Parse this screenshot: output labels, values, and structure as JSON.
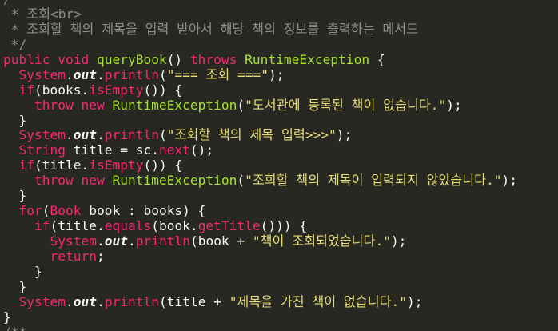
{
  "editor": {
    "lines": [
      [
        {
          "c": "comment",
          "t": "/"
        }
      ],
      [
        {
          "c": "comment",
          "t": " * 조회"
        },
        {
          "c": "tag",
          "t": "<br>"
        }
      ],
      [
        {
          "c": "comment",
          "t": " * 조회할 책의 제목을 입력 받아서 해당 책의 정보를 출력하는 메서드"
        }
      ],
      [
        {
          "c": "comment",
          "t": " */"
        }
      ],
      [
        {
          "c": "kw",
          "t": "public "
        },
        {
          "c": "kw",
          "t": "void "
        },
        {
          "c": "fn",
          "t": "queryBook"
        },
        {
          "c": "plain",
          "t": "() "
        },
        {
          "c": "kw",
          "t": "throws "
        },
        {
          "c": "cls",
          "t": "RuntimeException"
        },
        {
          "c": "plain",
          "t": " {"
        }
      ],
      [
        {
          "c": "plain",
          "t": "  "
        },
        {
          "c": "kw",
          "t": "System"
        },
        {
          "c": "plain",
          "t": "."
        },
        {
          "c": "field",
          "t": "out"
        },
        {
          "c": "plain",
          "t": "."
        },
        {
          "c": "kw",
          "t": "println"
        },
        {
          "c": "plain",
          "t": "("
        },
        {
          "c": "str",
          "t": "\"=== 조회 ===\""
        },
        {
          "c": "plain",
          "t": ");"
        }
      ],
      [
        {
          "c": "plain",
          "t": "  "
        },
        {
          "c": "kw",
          "t": "if"
        },
        {
          "c": "plain",
          "t": "(books."
        },
        {
          "c": "kw",
          "t": "isEmpty"
        },
        {
          "c": "plain",
          "t": "()) {"
        }
      ],
      [
        {
          "c": "plain",
          "t": "    "
        },
        {
          "c": "kw",
          "t": "throw new "
        },
        {
          "c": "cls",
          "t": "RuntimeException"
        },
        {
          "c": "plain",
          "t": "("
        },
        {
          "c": "str",
          "t": "\"도서관에 등록된 책이 없습니다.\""
        },
        {
          "c": "plain",
          "t": ");"
        }
      ],
      [
        {
          "c": "plain",
          "t": "  }"
        }
      ],
      [
        {
          "c": "plain",
          "t": "  "
        },
        {
          "c": "kw",
          "t": "System"
        },
        {
          "c": "plain",
          "t": "."
        },
        {
          "c": "field",
          "t": "out"
        },
        {
          "c": "plain",
          "t": "."
        },
        {
          "c": "kw",
          "t": "println"
        },
        {
          "c": "plain",
          "t": "("
        },
        {
          "c": "str",
          "t": "\"조회할 책의 제목 입력>>>\""
        },
        {
          "c": "plain",
          "t": ");"
        }
      ],
      [
        {
          "c": "plain",
          "t": "  "
        },
        {
          "c": "kw",
          "t": "String "
        },
        {
          "c": "plain",
          "t": "title = sc."
        },
        {
          "c": "kw",
          "t": "next"
        },
        {
          "c": "plain",
          "t": "();"
        }
      ],
      [
        {
          "c": "plain",
          "t": "  "
        },
        {
          "c": "kw",
          "t": "if"
        },
        {
          "c": "plain",
          "t": "(title."
        },
        {
          "c": "kw",
          "t": "isEmpty"
        },
        {
          "c": "plain",
          "t": "()) {"
        }
      ],
      [
        {
          "c": "plain",
          "t": "    "
        },
        {
          "c": "kw",
          "t": "throw new "
        },
        {
          "c": "cls",
          "t": "RuntimeException"
        },
        {
          "c": "plain",
          "t": "("
        },
        {
          "c": "str",
          "t": "\"조회할 책의 제목이 입력되지 않았습니다.\""
        },
        {
          "c": "plain",
          "t": ");"
        }
      ],
      [
        {
          "c": "plain",
          "t": "  }"
        }
      ],
      [
        {
          "c": "plain",
          "t": "  "
        },
        {
          "c": "kw",
          "t": "for"
        },
        {
          "c": "plain",
          "t": "("
        },
        {
          "c": "kw",
          "t": "Book "
        },
        {
          "c": "plain",
          "t": "book : books) {"
        }
      ],
      [
        {
          "c": "plain",
          "t": "    "
        },
        {
          "c": "kw",
          "t": "if"
        },
        {
          "c": "plain",
          "t": "(title."
        },
        {
          "c": "kw",
          "t": "equals"
        },
        {
          "c": "plain",
          "t": "(book."
        },
        {
          "c": "kw",
          "t": "getTitle"
        },
        {
          "c": "plain",
          "t": "())) {"
        }
      ],
      [
        {
          "c": "plain",
          "t": "      "
        },
        {
          "c": "kw",
          "t": "System"
        },
        {
          "c": "plain",
          "t": "."
        },
        {
          "c": "field",
          "t": "out"
        },
        {
          "c": "plain",
          "t": "."
        },
        {
          "c": "kw",
          "t": "println"
        },
        {
          "c": "plain",
          "t": "(book + "
        },
        {
          "c": "str",
          "t": "\"책이 조회되었습니다.\""
        },
        {
          "c": "plain",
          "t": ");"
        }
      ],
      [
        {
          "c": "plain",
          "t": "      "
        },
        {
          "c": "kw",
          "t": "return"
        },
        {
          "c": "plain",
          "t": ";"
        }
      ],
      [
        {
          "c": "plain",
          "t": "    }"
        }
      ],
      [
        {
          "c": "plain",
          "t": "  }"
        }
      ],
      [
        {
          "c": "plain",
          "t": "  "
        },
        {
          "c": "kw",
          "t": "System"
        },
        {
          "c": "plain",
          "t": "."
        },
        {
          "c": "field",
          "t": "out"
        },
        {
          "c": "plain",
          "t": "."
        },
        {
          "c": "kw",
          "t": "println"
        },
        {
          "c": "plain",
          "t": "(title + "
        },
        {
          "c": "str",
          "t": "\"제목을 가진 책이 없습니다.\""
        },
        {
          "c": "plain",
          "t": ");"
        }
      ],
      [
        {
          "c": "plain",
          "t": "}"
        }
      ],
      [
        {
          "c": "comment",
          "t": "/**"
        }
      ]
    ]
  },
  "colors": {
    "background": "#272822",
    "comment": "#8f8f86",
    "keyword": "#f92672",
    "string": "#e6db74",
    "function": "#a6e22e",
    "plain": "#f8f8f2"
  }
}
